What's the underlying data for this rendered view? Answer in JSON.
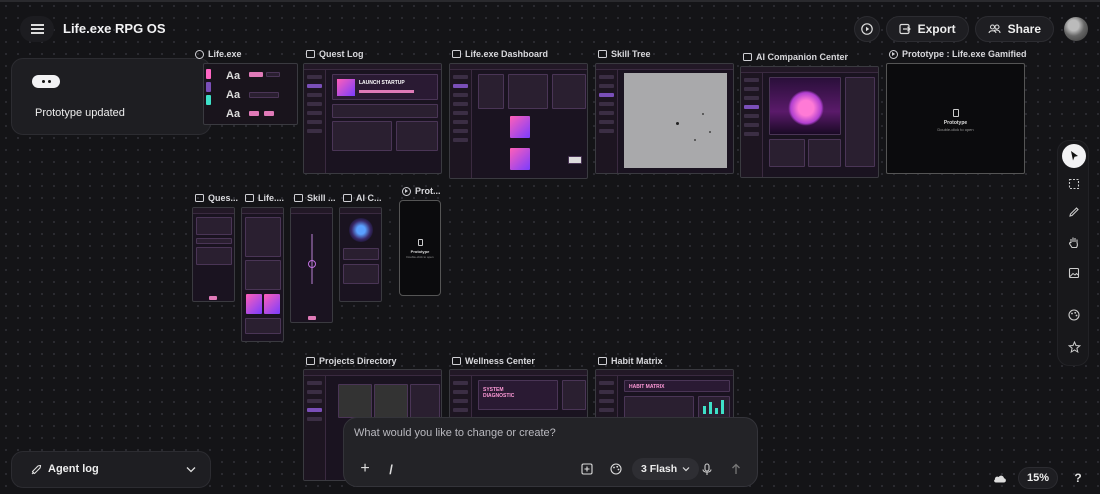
{
  "app": {
    "title": "Life.exe RPG OS"
  },
  "header": {
    "export_label": "Export",
    "share_label": "Share"
  },
  "toast": {
    "message": "Prototype updated"
  },
  "frames": {
    "lifeexe": "Life.exe",
    "questlog": "Quest Log",
    "dashboard": "Life.exe Dashboard",
    "skilltree": "Skill Tree",
    "aicompanion": "AI Companion Center",
    "prototype": "Prototype : Life.exe Gamified Pr...",
    "ques_m": "Ques...",
    "life_m": "Life....",
    "skill_m": "Skill ...",
    "ai_m": "AI C...",
    "prot_m": "Prot...",
    "projects": "Projects Directory",
    "wellness": "Wellness Center",
    "habit": "Habit Matrix"
  },
  "frame_content": {
    "launch_startup": "LAUNCH STARTUP",
    "aa": "Aa",
    "prototype_title": "Prototype",
    "prototype_sub": "Double-click to open",
    "system_diagnostic": "SYSTEM DIAGNOSTIC",
    "habit_matrix": "HABIT MATRIX"
  },
  "composer": {
    "placeholder": "What would you like to change or create?",
    "add_label": "+",
    "slash_label": "/",
    "model_label": "3 Flash"
  },
  "agent_log": {
    "label": "Agent log"
  },
  "zoom": {
    "level": "15%"
  },
  "help": {
    "label": "?"
  },
  "colors": {
    "accent": "#7a4fb8",
    "pink": "#e07ab8",
    "canvas_bg": "#141417"
  }
}
